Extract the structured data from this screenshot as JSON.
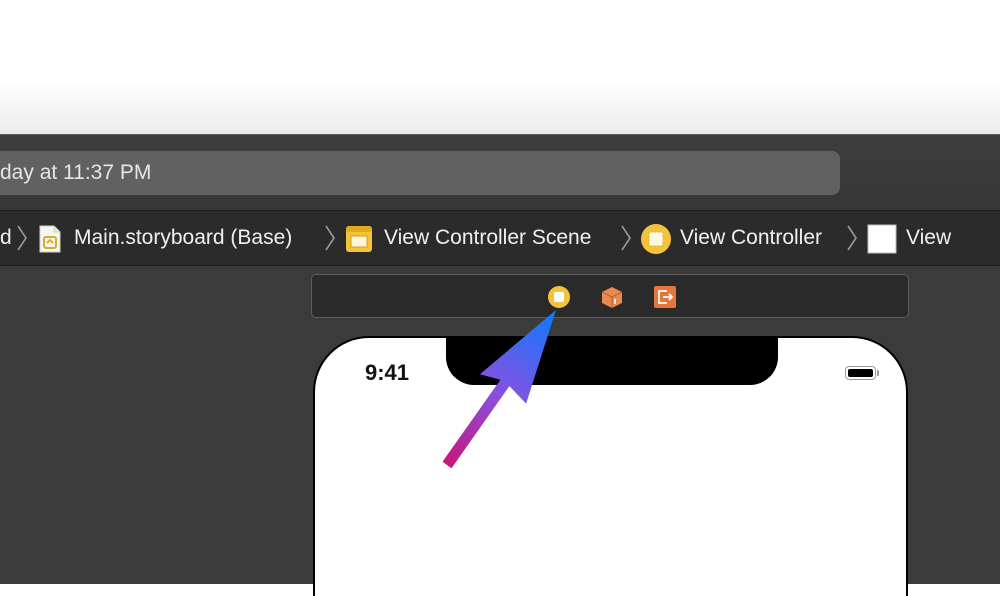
{
  "activity_bar": {
    "status_text": "day at 11:37 PM"
  },
  "jump_bar": {
    "partial_item": "d",
    "items": [
      {
        "label": "Main.storyboard (Base)",
        "icon": "storyboard-file-icon"
      },
      {
        "label": "View Controller Scene",
        "icon": "scene-icon"
      },
      {
        "label": "View Controller",
        "icon": "view-controller-icon"
      },
      {
        "label": "View",
        "icon": "view-icon"
      }
    ]
  },
  "scene_dock": {
    "icons": [
      "view-controller-icon",
      "first-responder-icon",
      "exit-icon"
    ]
  },
  "device": {
    "status_time": "9:41"
  },
  "annotation": {
    "icon": "pointer-arrow-icon"
  },
  "colors": {
    "view_controller_yellow": "#f5c33b",
    "first_responder_orange": "#e8894f",
    "exit_orange": "#e8763a",
    "arrow_start": "#c8167a",
    "arrow_end": "#0a7cff"
  }
}
